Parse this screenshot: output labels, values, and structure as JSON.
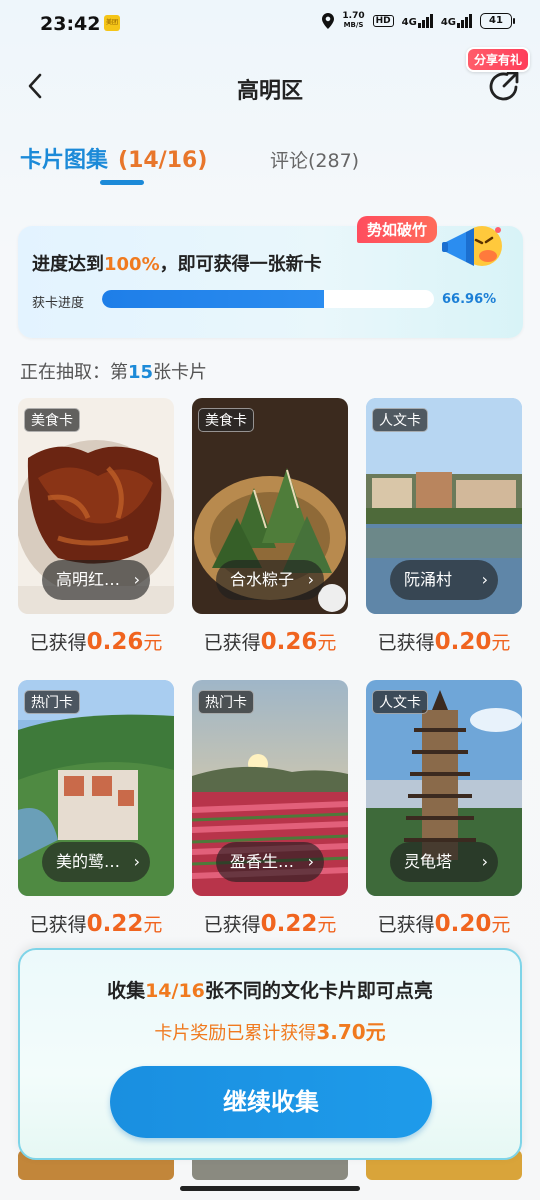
{
  "status_bar": {
    "time": "23:42",
    "app_badge": "美团",
    "speed_value": "1.70",
    "speed_unit": "MB/S",
    "hd": "HD",
    "net1": "4G",
    "net2": "4G",
    "battery": "41"
  },
  "header": {
    "title": "高明区",
    "share_tag": "分享有礼"
  },
  "tabs": {
    "cards_label": "卡片图集",
    "cards_count": "(14/16)",
    "comments_label": "评论(287)"
  },
  "progress": {
    "badge": "势如破竹",
    "text_prefix": "进度达到",
    "text_highlight": "100%",
    "text_suffix": "，即可获得一张新卡",
    "label": "获卡进度",
    "percent_text": "66.96%",
    "fraction": 0.6696
  },
  "drawing": {
    "prefix": "正在抽取：第",
    "number": "15",
    "suffix": "张卡片"
  },
  "cards": [
    {
      "tag": "美食卡",
      "name": "高明红…",
      "earned_label": "已获得",
      "amount": "0.26",
      "unit": "元"
    },
    {
      "tag": "美食卡",
      "name": "合水粽子",
      "earned_label": "已获得",
      "amount": "0.26",
      "unit": "元"
    },
    {
      "tag": "人文卡",
      "name": "阮涌村",
      "earned_label": "已获得",
      "amount": "0.20",
      "unit": "元"
    },
    {
      "tag": "热门卡",
      "name": "美的鹭…",
      "earned_label": "已获得",
      "amount": "0.22",
      "unit": "元"
    },
    {
      "tag": "热门卡",
      "name": "盈香生…",
      "earned_label": "已获得",
      "amount": "0.22",
      "unit": "元"
    },
    {
      "tag": "人文卡",
      "name": "灵龟塔",
      "earned_label": "已获得",
      "amount": "0.20",
      "unit": "元"
    }
  ],
  "bottom": {
    "line1_prefix": "收集",
    "line1_highlight": "14/16",
    "line1_suffix": "张不同的文化卡片即可点亮",
    "line2_prefix": "卡片奖励已累计获得",
    "line2_amount": "3.70元",
    "button": "继续收集"
  },
  "colors": {
    "accent_blue": "#1c8ad8",
    "accent_orange": "#f0641f",
    "badge_red": "#ff4d5e"
  }
}
